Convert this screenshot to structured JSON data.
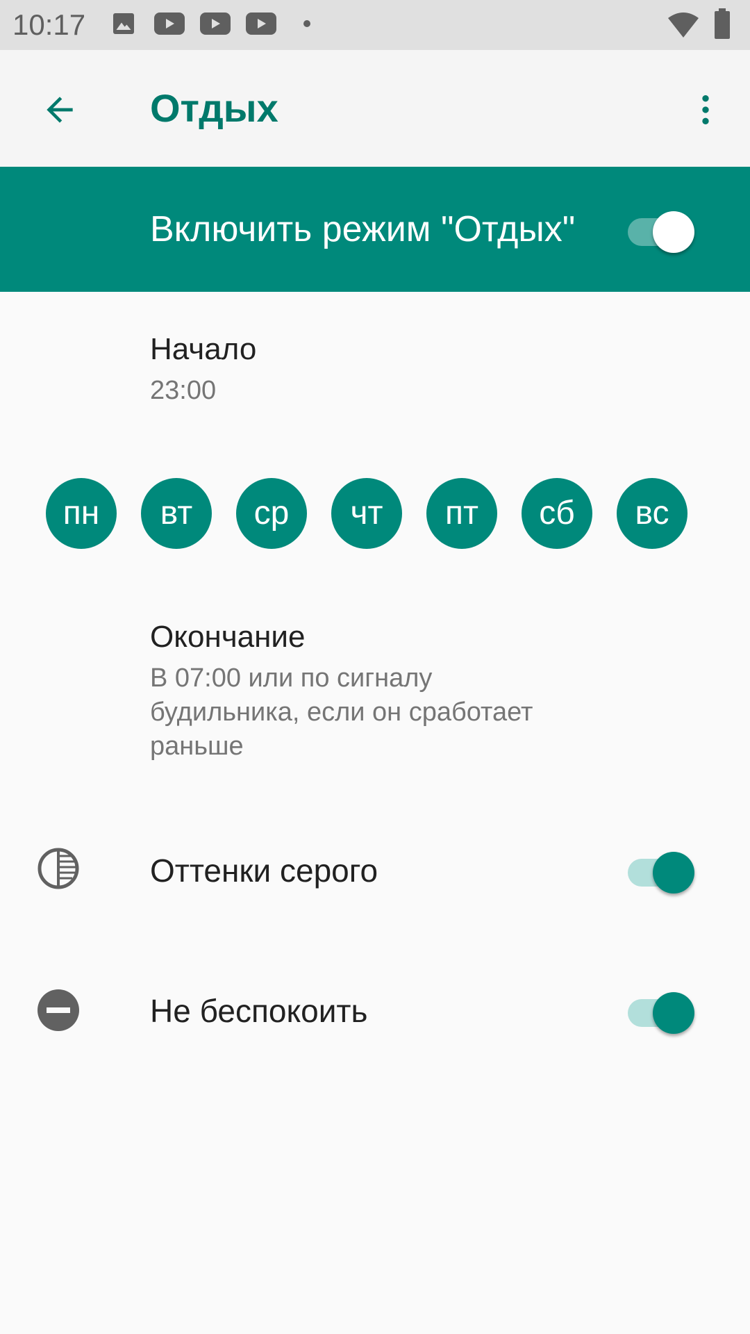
{
  "status_bar": {
    "time": "10:17",
    "left_icons": [
      "image-icon",
      "youtube-icon",
      "youtube-icon",
      "youtube-icon",
      "dot-icon"
    ],
    "right_icons": [
      "wifi-icon",
      "battery-icon"
    ]
  },
  "app_bar": {
    "title": "Отдых",
    "back_icon": "arrow-back-icon",
    "more_icon": "more-vert-icon"
  },
  "master": {
    "label": "Включить режим \"Отдых\"",
    "enabled": true
  },
  "start": {
    "title": "Начало",
    "value": "23:00"
  },
  "days": [
    "пн",
    "вт",
    "ср",
    "чт",
    "пт",
    "сб",
    "вс"
  ],
  "end": {
    "title": "Окончание",
    "line1": "В 07:00 или по сигналу",
    "line2": "будильника, если он сработает",
    "line3": "раньше"
  },
  "grayscale": {
    "label": "Оттенки серого",
    "icon": "grayscale-icon",
    "enabled": true
  },
  "dnd": {
    "label": "Не беспокоить",
    "icon": "do-not-disturb-icon",
    "enabled": true
  },
  "colors": {
    "accent": "#00897b",
    "title_accent": "#00796b",
    "switch_track": "#b2dfdb"
  }
}
